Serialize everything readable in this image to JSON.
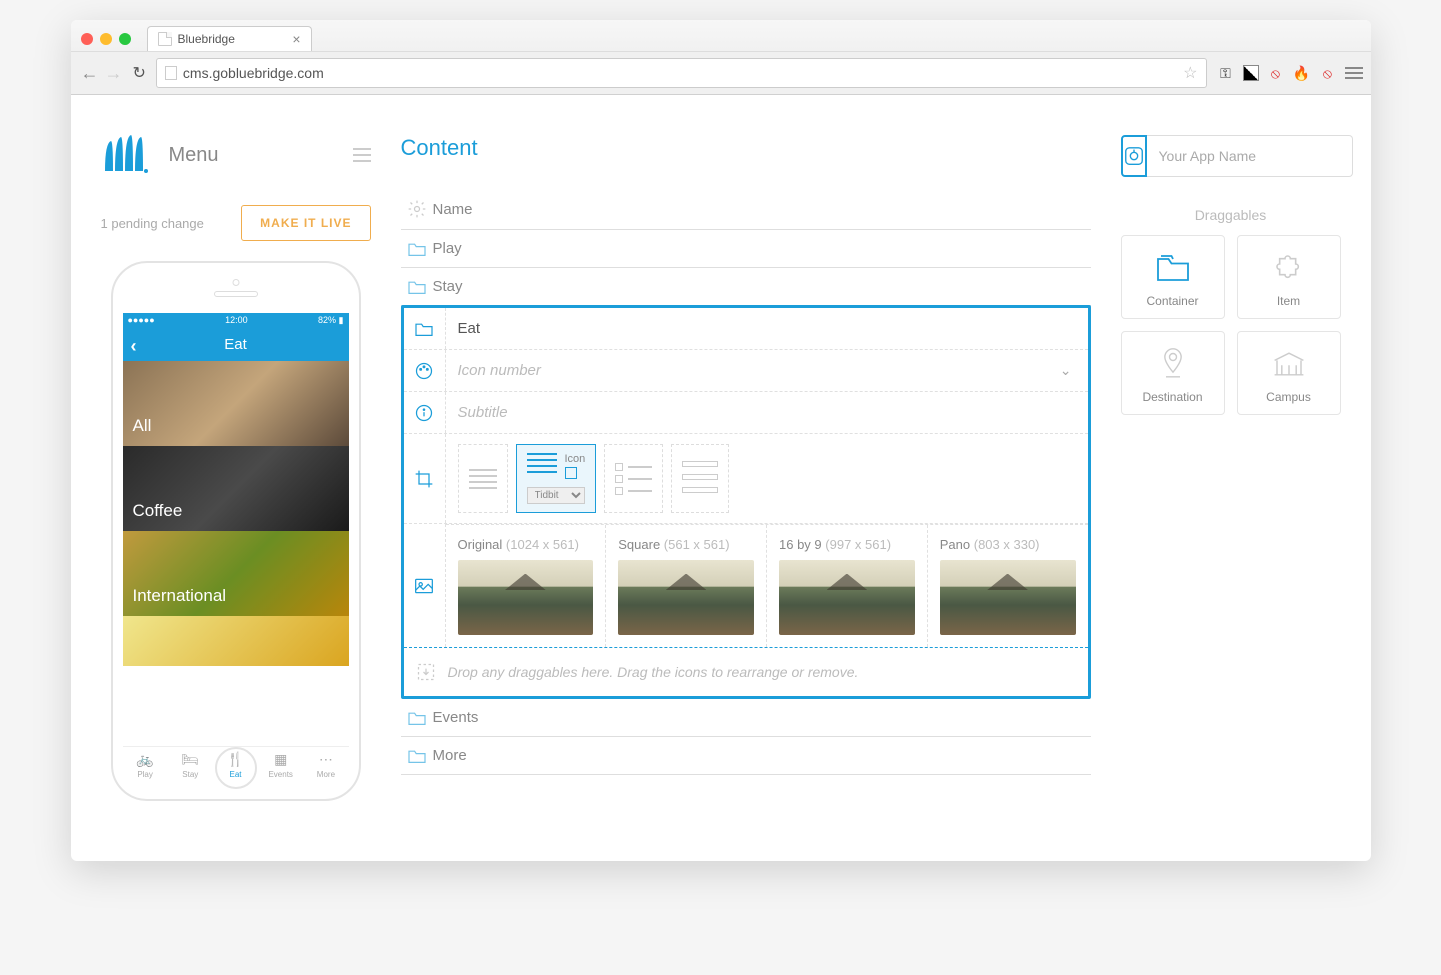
{
  "browser": {
    "tab_title": "Bluebridge",
    "url": "cms.gobluebridge.com"
  },
  "sidebar": {
    "menu_label": "Menu",
    "pending_text": "1 pending change",
    "make_live_label": "MAKE IT LIVE"
  },
  "phone": {
    "status": {
      "carrier": "●●●●●",
      "time": "12:00",
      "battery": "82%"
    },
    "header": "Eat",
    "rows": [
      "All",
      "Coffee",
      "International"
    ],
    "tabs": [
      {
        "label": "Play"
      },
      {
        "label": "Stay"
      },
      {
        "label": "Eat"
      },
      {
        "label": "Events"
      },
      {
        "label": "More"
      }
    ]
  },
  "content": {
    "title": "Content",
    "name_row": "Name",
    "rows_top": [
      "Play",
      "Stay"
    ],
    "editor": {
      "name": "Eat",
      "icon_placeholder": "Icon number",
      "subtitle_placeholder": "Subtitle",
      "layout_icon_label": "Icon",
      "tidbit_selected": "Tidbit",
      "images": [
        {
          "name": "Original",
          "dims": "(1024 x  561)"
        },
        {
          "name": "Square",
          "dims": "(561 x 561)"
        },
        {
          "name": "16 by 9",
          "dims": "(997 x 561)"
        },
        {
          "name": "Pano",
          "dims": "(803 x 330)"
        }
      ],
      "dropzone_text": "Drop any draggables here. Drag the icons to rearrange or remove."
    },
    "rows_bottom": [
      "Events",
      "More"
    ]
  },
  "right": {
    "app_name_placeholder": "Your App Name",
    "draggables_title": "Draggables",
    "items": [
      "Container",
      "Item",
      "Destination",
      "Campus"
    ]
  }
}
